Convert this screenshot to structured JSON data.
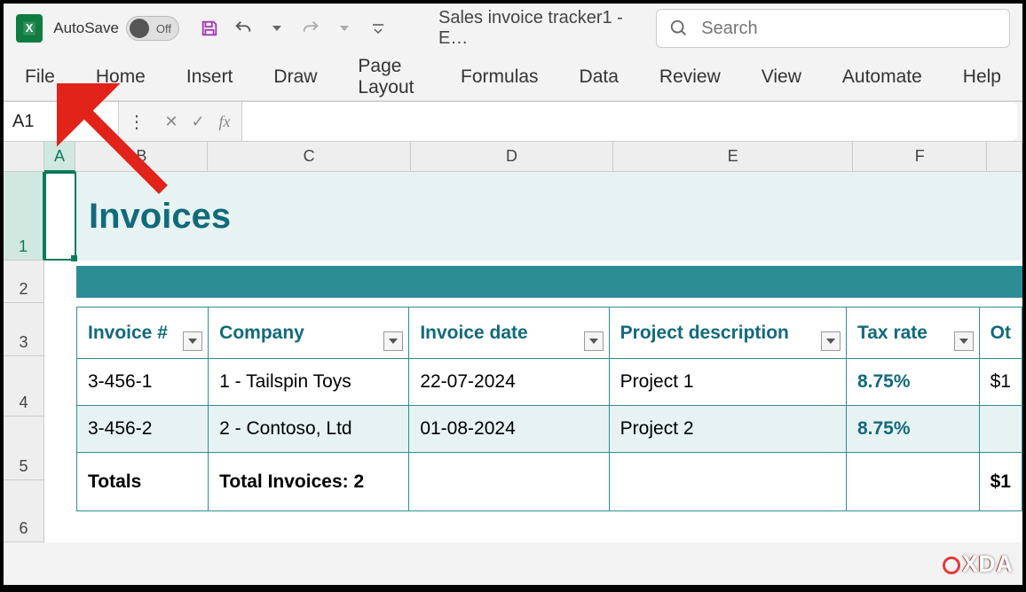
{
  "titlebar": {
    "autosave_label": "AutoSave",
    "autosave_state": "Off",
    "document_title": "Sales invoice tracker1  -  E…",
    "search_placeholder": "Search"
  },
  "ribbon": {
    "tabs": [
      "File",
      "Home",
      "Insert",
      "Draw",
      "Page Layout",
      "Formulas",
      "Data",
      "Review",
      "View",
      "Automate",
      "Help"
    ]
  },
  "namebox": {
    "value": "A1"
  },
  "columns": [
    "A",
    "B",
    "C",
    "D",
    "E",
    "F"
  ],
  "rows": [
    "1",
    "2",
    "3",
    "4",
    "5",
    "6"
  ],
  "sheet": {
    "title": "Invoices",
    "headers": {
      "invoice": "Invoice #",
      "company": "Company",
      "date": "Invoice date",
      "project": "Project description",
      "tax": "Tax rate",
      "other": "Ot"
    },
    "rowsdata": [
      {
        "invoice": "3-456-1",
        "company": "1 - Tailspin Toys",
        "date": "22-07-2024",
        "project": "Project 1",
        "tax": "8.75%",
        "other": "$1"
      },
      {
        "invoice": "3-456-2",
        "company": "2 - Contoso, Ltd",
        "date": "01-08-2024",
        "project": "Project 2",
        "tax": "8.75%",
        "other": ""
      }
    ],
    "totals": {
      "label": "Totals",
      "count": "Total Invoices: 2",
      "other": "$1"
    }
  },
  "watermark": "XDA"
}
